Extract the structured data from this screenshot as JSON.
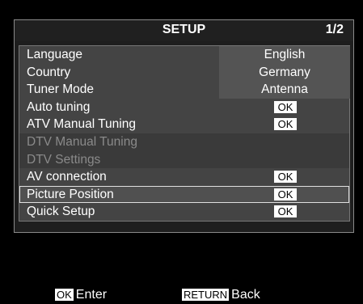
{
  "header": {
    "title": "SETUP",
    "page": "1/2"
  },
  "rows": [
    {
      "label": "Language",
      "value": "English"
    },
    {
      "label": "Country",
      "value": "Germany"
    },
    {
      "label": "Tuner Mode",
      "value": "Antenna"
    },
    {
      "label": "Auto tuning",
      "ok": "OK"
    },
    {
      "label": "ATV Manual Tuning",
      "ok": "OK"
    },
    {
      "label": "DTV Manual Tuning"
    },
    {
      "label": "DTV Settings"
    },
    {
      "label": "AV connection",
      "ok": "OK"
    },
    {
      "label": "Picture Position",
      "ok": "OK"
    },
    {
      "label": "Quick Setup",
      "ok": "OK"
    }
  ],
  "footer": {
    "enter_key": "OK",
    "enter_label": "Enter",
    "back_key": "RETURN",
    "back_label": "Back"
  }
}
